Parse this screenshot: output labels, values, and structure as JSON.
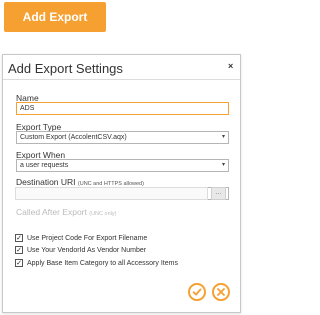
{
  "toolbar": {
    "add_export_label": "Add Export"
  },
  "dialog": {
    "title": "Add Export Settings",
    "close_glyph": "×",
    "name": {
      "label": "Name",
      "value": "ADS"
    },
    "export_type": {
      "label": "Export Type",
      "value": "Custom Export (AccolentCSV.aqx)"
    },
    "export_when": {
      "label": "Export When",
      "value": "a user requests"
    },
    "destination_uri": {
      "label": "Destination URI",
      "hint": "(UNC and HTTPS allowed)",
      "value": ""
    },
    "called_after_export": {
      "label": "Called After Export",
      "hint": "(UNC only)",
      "value": "",
      "browse_label": "..."
    },
    "checkboxes": [
      {
        "label": "Use Project Code For Export Filename",
        "checked": true
      },
      {
        "label": "Use Your VendorId As Vendor Number",
        "checked": true
      },
      {
        "label": "Apply Base Item Category to all Accessory Items",
        "checked": true
      }
    ],
    "checkmark_glyph": "✓",
    "actions": {
      "confirm_icon": "check-icon",
      "cancel_icon": "close-icon"
    }
  },
  "colors": {
    "accent": "#f5a031",
    "border": "#b5b5b5",
    "disabled_text": "#bbbbbb"
  }
}
